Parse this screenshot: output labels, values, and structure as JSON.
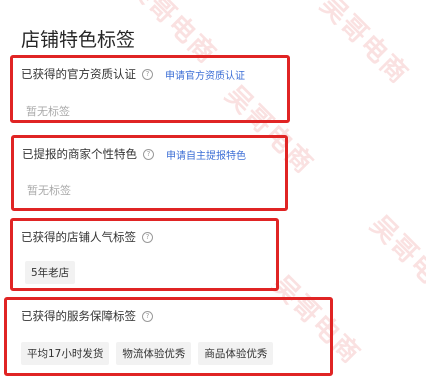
{
  "page_title": "店铺特色标签",
  "watermark": "吴哥电商",
  "sections": [
    {
      "title": "已获得的官方资质认证",
      "help_icon": "question-circle-icon",
      "link": "申请官方资质认证",
      "empty": "暂无标签"
    },
    {
      "title": "已提报的商家个性特色",
      "help_icon": "question-circle-icon",
      "link": "申请自主提报特色",
      "empty": "暂无标签"
    },
    {
      "title": "已获得的店铺人气标签",
      "help_icon": "question-circle-icon",
      "tags": [
        "5年老店"
      ]
    },
    {
      "title": "已获得的服务保障标签",
      "help_icon": "question-circle-icon",
      "tags": [
        "平均17小时发货",
        "物流体验优秀",
        "商品体验优秀"
      ]
    }
  ],
  "colors": {
    "highlight_border": "#e02424",
    "link": "#3d6fd6",
    "tag_bg": "#f2f2f2",
    "muted_text": "#aaaaaa"
  }
}
